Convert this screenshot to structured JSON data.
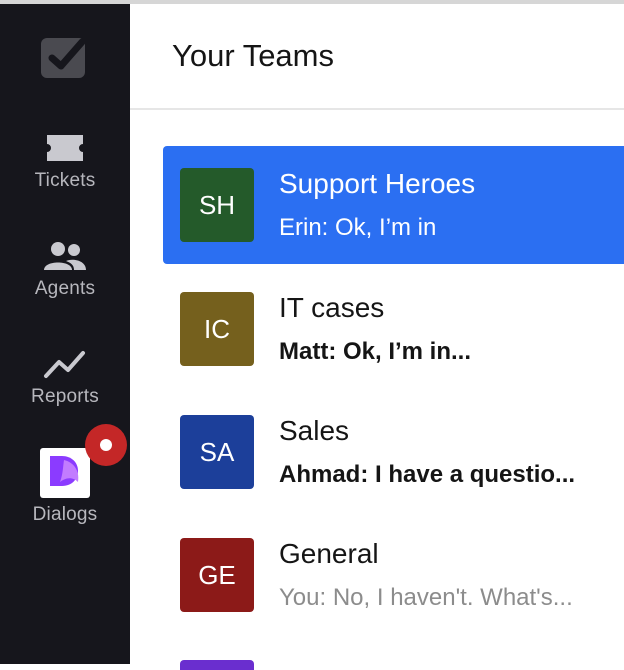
{
  "header": {
    "title": "Your Teams"
  },
  "sidebar": {
    "items": [
      {
        "label": "Tickets",
        "icon": "ticket-icon"
      },
      {
        "label": "Agents",
        "icon": "agents-icon"
      },
      {
        "label": "Reports",
        "icon": "reports-icon"
      },
      {
        "label": "Dialogs",
        "icon": "dialogs-icon",
        "badge": true
      }
    ],
    "logo_icon": "checkbox-logo-icon"
  },
  "teams": [
    {
      "initials": "SH",
      "name": "Support Heroes",
      "message": "Erin: Ok, I’m in",
      "avatar_color": "#245a2a",
      "selected": true
    },
    {
      "initials": "IC",
      "name": "IT cases",
      "message": "Matt: Ok, I’m in...",
      "avatar_color": "#75601d",
      "unread": true
    },
    {
      "initials": "SA",
      "name": "Sales",
      "message": "Ahmad: I have a questio...",
      "avatar_color": "#1c3f9a",
      "unread": true
    },
    {
      "initials": "GE",
      "name": "General",
      "message": "You: No, I haven't. What's...",
      "avatar_color": "#8c1a18",
      "unread": false
    }
  ],
  "colors": {
    "sidebar_bg": "#16161c",
    "accent": "#2b6ff2",
    "badge": "#c42727",
    "next_avatar": "#6a2ecf"
  }
}
